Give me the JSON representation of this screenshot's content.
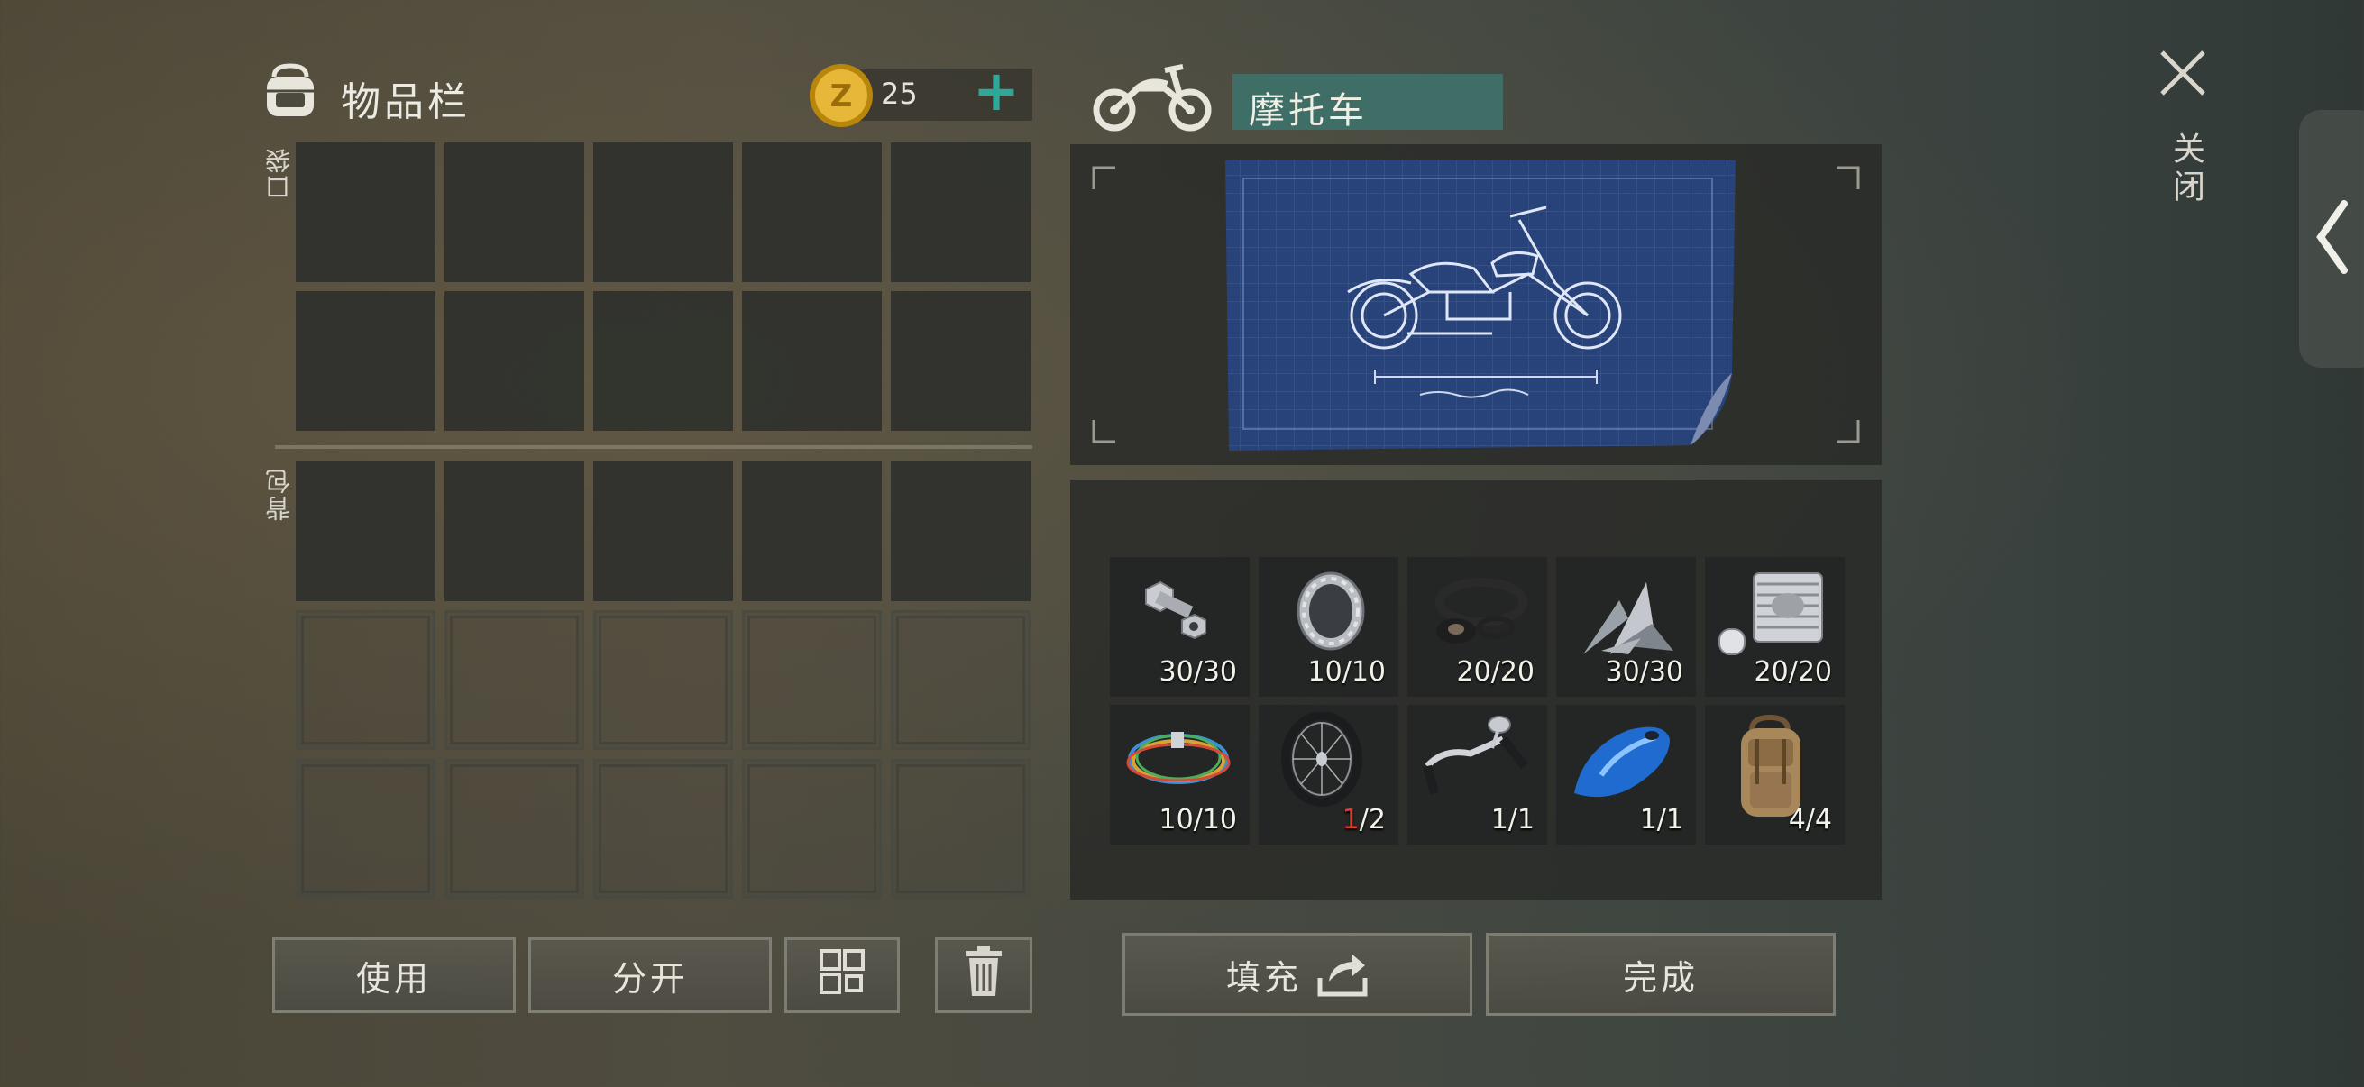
{
  "inventory": {
    "title": "物品栏",
    "coins": "25",
    "add_symbol": "+",
    "pocket_label": "口袋",
    "backpack_label": "背包"
  },
  "craft": {
    "title": "摩托车",
    "parts": [
      {
        "icon": "bolt-nut-icon",
        "count": "30/30",
        "have": "",
        "need": ""
      },
      {
        "icon": "bearing-icon",
        "count": "10/10",
        "have": "",
        "need": ""
      },
      {
        "icon": "gasket-icon",
        "count": "20/20",
        "have": "",
        "need": ""
      },
      {
        "icon": "scrap-metal-icon",
        "count": "30/30",
        "have": "",
        "need": ""
      },
      {
        "icon": "engine-cylinder-icon",
        "count": "20/20",
        "have": "",
        "need": ""
      },
      {
        "icon": "wires-icon",
        "count": "10/10",
        "have": "",
        "need": ""
      },
      {
        "icon": "wheel-icon",
        "count": "",
        "have": "1",
        "need": "/2"
      },
      {
        "icon": "handlebar-icon",
        "count": "1/1",
        "have": "",
        "need": ""
      },
      {
        "icon": "fuel-tank-icon",
        "count": "1/1",
        "have": "",
        "need": ""
      },
      {
        "icon": "backpack-icon",
        "count": "4/4",
        "have": "",
        "need": ""
      }
    ]
  },
  "buttons": {
    "use": "使用",
    "split": "分开",
    "fill": "填充",
    "done": "完成"
  },
  "close_label": "关闭",
  "colors": {
    "title_bg": "#3e6e66",
    "accent_plus": "#2fa89a",
    "missing_red": "#e03a2a"
  }
}
